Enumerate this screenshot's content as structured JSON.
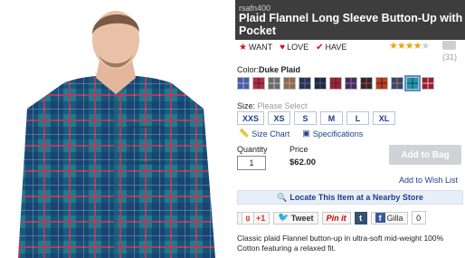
{
  "product": {
    "sku": "rsafn400",
    "title": "Plaid Flannel Long Sleeve Button-Up with Pocket"
  },
  "actions": [
    {
      "label": "WANT",
      "icon": "star-icon"
    },
    {
      "label": "LOVE",
      "icon": "heart-icon"
    },
    {
      "label": "HAVE",
      "icon": "check-icon"
    }
  ],
  "rating": {
    "stars": 4,
    "max": 5,
    "count": "(31)"
  },
  "color": {
    "label": "Color:",
    "selected": "Duke Plaid",
    "swatches": [
      {
        "c1": "#3a5fb5",
        "c2": "#d4a9b4"
      },
      {
        "c1": "#b72c36",
        "c2": "#2a2a5a"
      },
      {
        "c1": "#6b6b6b",
        "c2": "#c3c3c3"
      },
      {
        "c1": "#8c6a56",
        "c2": "#c99a80"
      },
      {
        "c1": "#2b3350",
        "c2": "#5a6a8c"
      },
      {
        "c1": "#1f2940",
        "c2": "#4e4e7e"
      },
      {
        "c1": "#a32036",
        "c2": "#2e2e46"
      },
      {
        "c1": "#442e5c",
        "c2": "#8c6ca8"
      },
      {
        "c1": "#2a2a2a",
        "c2": "#b94040"
      },
      {
        "c1": "#c93a1b",
        "c2": "#2a2a2a"
      },
      {
        "c1": "#2d4a76",
        "c2": "#d2693b"
      },
      {
        "c1": "#1e9aa0",
        "c2": "#1a3a7a"
      },
      {
        "c1": "#a31a2a",
        "c2": "#d0d0d0"
      }
    ],
    "selected_index": 11
  },
  "size": {
    "label": "Size:",
    "hint": "Please Select",
    "options": [
      "XXS",
      "XS",
      "S",
      "M",
      "L",
      "XL"
    ]
  },
  "links": {
    "size_chart": "Size Chart",
    "specifications": "Specifications"
  },
  "purchase": {
    "quantity_label": "Quantity",
    "quantity_value": "1",
    "price_label": "Price",
    "price_value": "$62.00",
    "add_to_bag": "Add to Bag",
    "add_to_wish": "Add to Wish List"
  },
  "locate": "Locate This Item at a Nearby Store",
  "social": {
    "gplus": "+1",
    "tweet": "Tweet",
    "pinit": "Pin it",
    "tumblr": "t",
    "fb": "f",
    "gilla": "Gilla",
    "count": "0"
  },
  "description": "Classic plaid Flannel button-up in ultra-soft mid-weight 100% Cotton featuring a relaxed fit.",
  "colors": {
    "title_bg": "#3d3d3d",
    "link": "#1d3f8a",
    "accent_red": "#cc1122",
    "shirt": "#1a8f9a"
  }
}
